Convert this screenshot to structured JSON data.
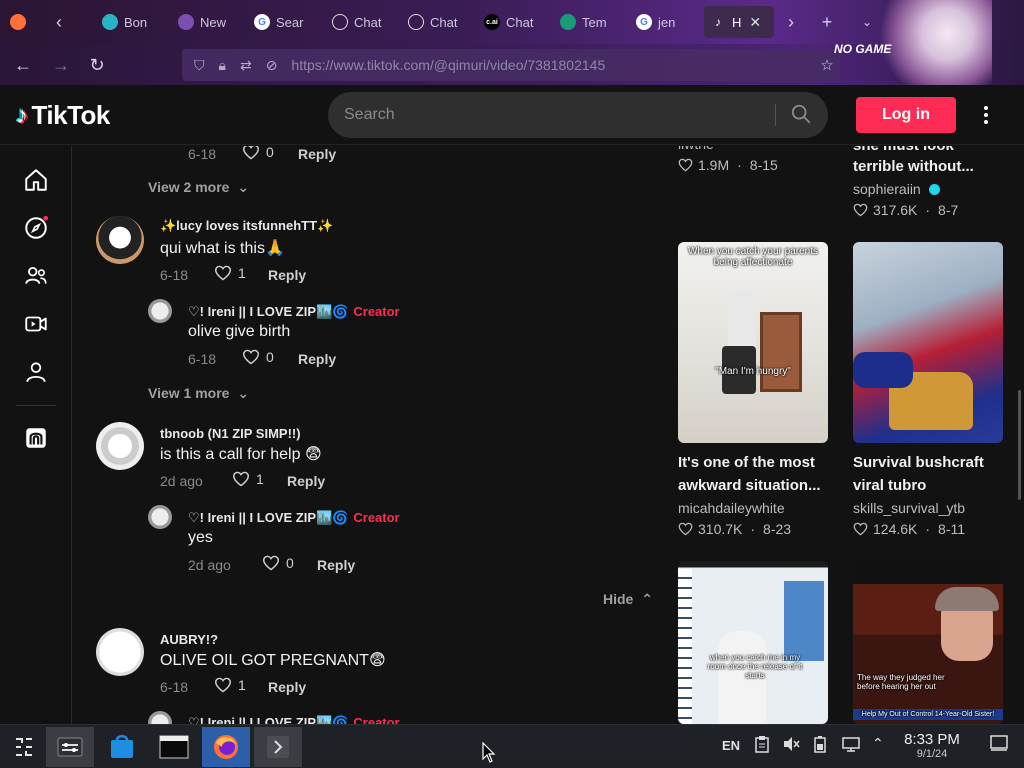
{
  "browser": {
    "tabs": [
      {
        "label": "Bon",
        "icon": "bonk-icon"
      },
      {
        "label": "New",
        "icon": "new-tab-icon"
      },
      {
        "label": "Sear",
        "icon": "google-icon"
      },
      {
        "label": "Chat",
        "icon": "chatgpt-icon"
      },
      {
        "label": "Chat",
        "icon": "chatgpt-icon"
      },
      {
        "label": "Chat",
        "icon": "characterai-icon"
      },
      {
        "label": "Tem",
        "icon": "tempmail-icon"
      },
      {
        "label": "jen",
        "icon": "google-icon"
      },
      {
        "label": "H",
        "icon": "tiktok-icon"
      }
    ],
    "url": "https://www.tiktok.com/@qimuri/video/7381802145",
    "theme_text": "NO GAME"
  },
  "header": {
    "logo_text": "TikTok",
    "search_placeholder": "Search",
    "login_label": "Log in"
  },
  "comments": [
    {
      "type": "meta",
      "date": "6-18",
      "likes": "0",
      "reply": "Reply"
    },
    {
      "type": "viewmore",
      "label": "View 2 more"
    },
    {
      "type": "comment",
      "user": "✨lucy loves itsfunnehTT✨",
      "text": "qui what is this🙏",
      "date": "6-18",
      "likes": "1",
      "reply": "Reply"
    },
    {
      "type": "reply",
      "user": "♡! Ireni || I LOVE ZIP🏙️🌀",
      "badge": "Creator",
      "text": "olive give birth",
      "date": "6-18",
      "likes": "0",
      "reply": "Reply"
    },
    {
      "type": "viewmore",
      "label": "View 1 more"
    },
    {
      "type": "comment",
      "user": "tbnoob (N1 ZIP SIMP!!)",
      "text": "is this a call for help 😨",
      "date": "2d ago",
      "likes": "1",
      "reply": "Reply"
    },
    {
      "type": "reply",
      "user": "♡! Ireni || I LOVE ZIP🏙️🌀",
      "badge": "Creator",
      "text": "yes",
      "date": "2d ago",
      "likes": "0",
      "reply": "Reply"
    },
    {
      "type": "hide",
      "label": "Hide"
    },
    {
      "type": "comment",
      "user": "AUBRY!?",
      "text": "OLIVE OIL GOT PREGNANT😨",
      "date": "6-18",
      "likes": "1",
      "reply": "Reply"
    },
    {
      "type": "reply-partial",
      "user": "♡! Ireni || I LOVE ZIP🏙️🌀",
      "badge": "Creator"
    }
  ],
  "videos": {
    "top_left": {
      "user": "iiwthe",
      "views": "1.9M",
      "date": "8-15"
    },
    "top_right": {
      "title_line1": "she must look",
      "title_line2": "terrible without...",
      "user": "sophieraiin",
      "verified": true,
      "views": "317.6K",
      "date": "8-7"
    },
    "mid_left": {
      "thumb_caption_top": "When you catch your parents being affectionate",
      "thumb_caption_mid": "\"Man I'm hungry\"",
      "title_line1": "It's one of the most",
      "title_line2": "awkward situation...",
      "user": "micahdaileywhite",
      "views": "310.7K",
      "date": "8-23"
    },
    "mid_right": {
      "title_line1": "Survival bushcraft",
      "title_line2": "viral tubro",
      "user": "skills_survival_ytb",
      "views": "124.6K",
      "date": "8-11"
    },
    "bottom_left": {
      "thumb_caption": "when you catch me in my room once the release of it starts"
    },
    "bottom_right": {
      "thumb_caption": "The way they judged her before hearing her out",
      "banner": "Help My Out of Control 14-Year-Old Sister!"
    }
  },
  "taskbar": {
    "lang": "EN",
    "time": "8:33 PM",
    "date": "9/1/24"
  },
  "colors": {
    "accent": "#fe2c55",
    "bg": "#121212",
    "verified": "#20d5ec"
  }
}
